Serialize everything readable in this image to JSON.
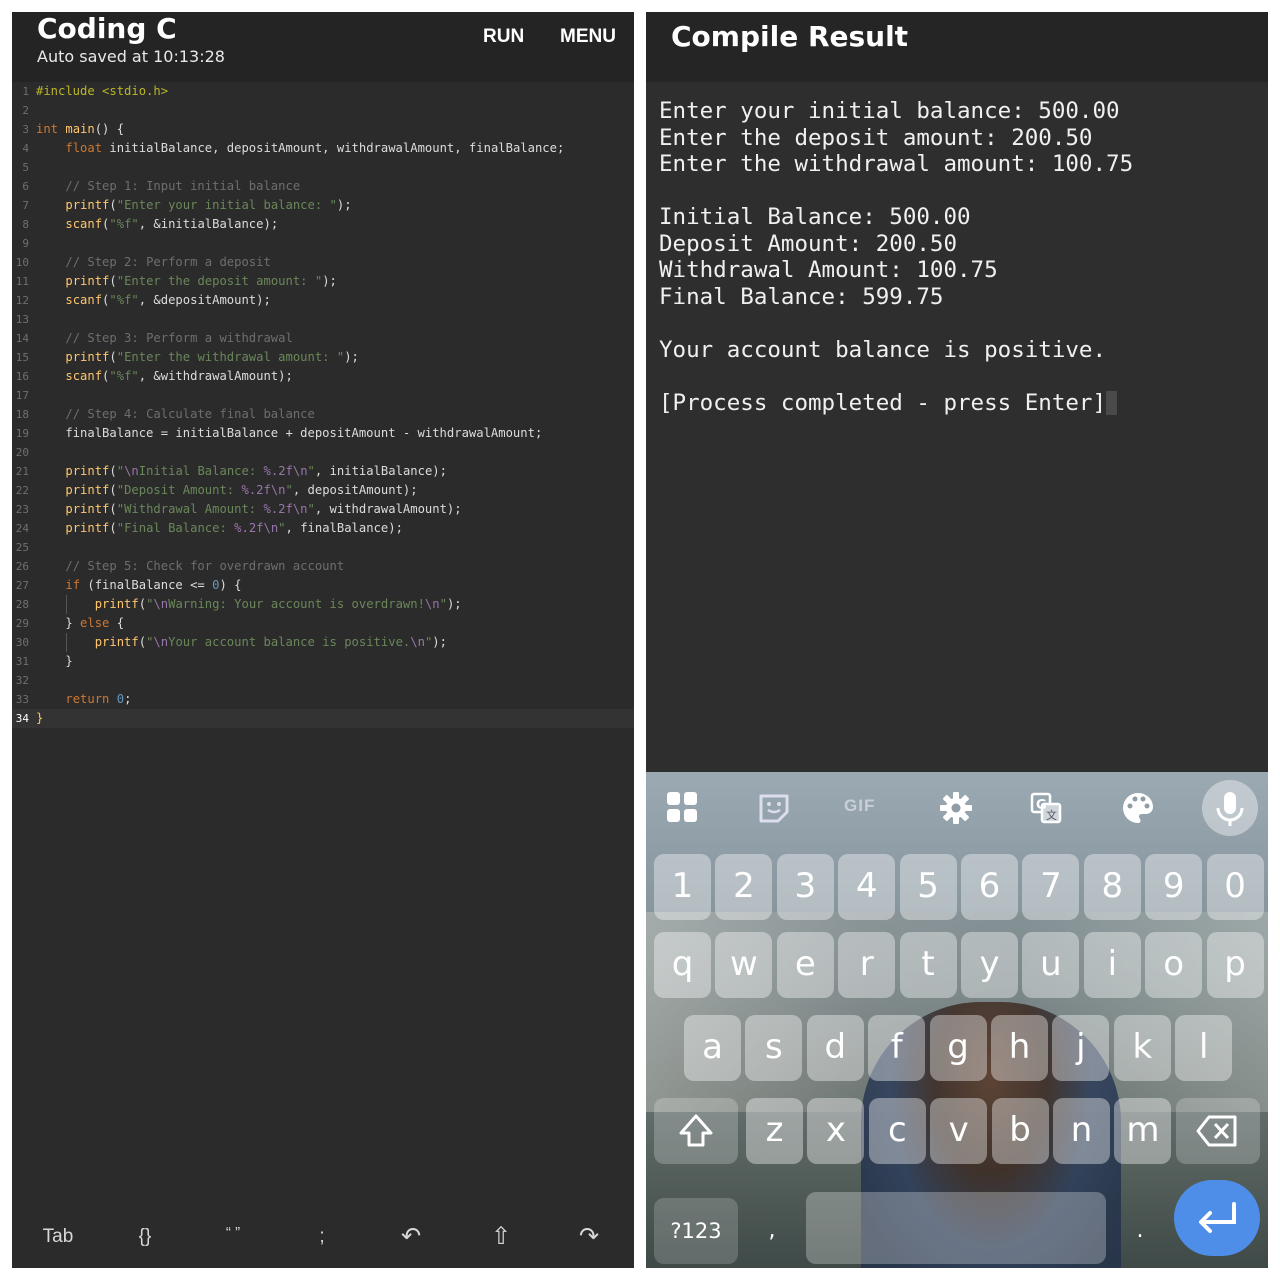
{
  "editor": {
    "app_title": "Coding C",
    "autosave": "Auto saved at 10:13:28",
    "run_label": "RUN",
    "menu_label": "MENU",
    "lines": [
      {
        "n": "1",
        "tokens": [
          [
            "pp",
            "#include <stdio.h>"
          ]
        ]
      },
      {
        "n": "2",
        "tokens": []
      },
      {
        "n": "3",
        "tokens": [
          [
            "kw",
            "int "
          ],
          [
            "fn",
            "main"
          ],
          [
            "plain",
            "() {"
          ]
        ]
      },
      {
        "n": "4",
        "tokens": [
          [
            "plain",
            "    "
          ],
          [
            "kw",
            "float "
          ],
          [
            "plain",
            "initialBalance, depositAmount, withdrawalAmount, finalBalance;"
          ]
        ]
      },
      {
        "n": "5",
        "tokens": []
      },
      {
        "n": "6",
        "tokens": [
          [
            "plain",
            "    "
          ],
          [
            "com",
            "// Step 1: Input initial balance"
          ]
        ]
      },
      {
        "n": "7",
        "tokens": [
          [
            "plain",
            "    "
          ],
          [
            "fn",
            "printf"
          ],
          [
            "plain",
            "("
          ],
          [
            "str",
            "\"Enter your initial balance: \""
          ],
          [
            "plain",
            ");"
          ]
        ]
      },
      {
        "n": "8",
        "tokens": [
          [
            "plain",
            "    "
          ],
          [
            "fn",
            "scanf"
          ],
          [
            "plain",
            "("
          ],
          [
            "str",
            "\"%f\""
          ],
          [
            "plain",
            ", &initialBalance);"
          ]
        ]
      },
      {
        "n": "9",
        "tokens": []
      },
      {
        "n": "10",
        "tokens": [
          [
            "plain",
            "    "
          ],
          [
            "com",
            "// Step 2: Perform a deposit"
          ]
        ]
      },
      {
        "n": "11",
        "tokens": [
          [
            "plain",
            "    "
          ],
          [
            "fn",
            "printf"
          ],
          [
            "plain",
            "("
          ],
          [
            "str",
            "\"Enter the deposit amount: \""
          ],
          [
            "plain",
            ");"
          ]
        ]
      },
      {
        "n": "12",
        "tokens": [
          [
            "plain",
            "    "
          ],
          [
            "fn",
            "scanf"
          ],
          [
            "plain",
            "("
          ],
          [
            "str",
            "\"%f\""
          ],
          [
            "plain",
            ", &depositAmount);"
          ]
        ]
      },
      {
        "n": "13",
        "tokens": []
      },
      {
        "n": "14",
        "tokens": [
          [
            "plain",
            "    "
          ],
          [
            "com",
            "// Step 3: Perform a withdrawal"
          ]
        ]
      },
      {
        "n": "15",
        "tokens": [
          [
            "plain",
            "    "
          ],
          [
            "fn",
            "printf"
          ],
          [
            "plain",
            "("
          ],
          [
            "str",
            "\"Enter the withdrawal amount: \""
          ],
          [
            "plain",
            ");"
          ]
        ]
      },
      {
        "n": "16",
        "tokens": [
          [
            "plain",
            "    "
          ],
          [
            "fn",
            "scanf"
          ],
          [
            "plain",
            "("
          ],
          [
            "str",
            "\"%f\""
          ],
          [
            "plain",
            ", &withdrawalAmount);"
          ]
        ]
      },
      {
        "n": "17",
        "tokens": []
      },
      {
        "n": "18",
        "tokens": [
          [
            "plain",
            "    "
          ],
          [
            "com",
            "// Step 4: Calculate final balance"
          ]
        ]
      },
      {
        "n": "19",
        "tokens": [
          [
            "plain",
            "    finalBalance = initialBalance + depositAmount - withdrawalAmount;"
          ]
        ]
      },
      {
        "n": "20",
        "tokens": []
      },
      {
        "n": "21",
        "tokens": [
          [
            "plain",
            "    "
          ],
          [
            "fn",
            "printf"
          ],
          [
            "plain",
            "("
          ],
          [
            "str",
            "\""
          ],
          [
            "esc",
            "\\n"
          ],
          [
            "str",
            "Initial Balance: "
          ],
          [
            "esc",
            "%.2f\\n"
          ],
          [
            "str",
            "\""
          ],
          [
            "plain",
            ", initialBalance);"
          ]
        ]
      },
      {
        "n": "22",
        "tokens": [
          [
            "plain",
            "    "
          ],
          [
            "fn",
            "printf"
          ],
          [
            "plain",
            "("
          ],
          [
            "str",
            "\"Deposit Amount: "
          ],
          [
            "esc",
            "%.2f\\n"
          ],
          [
            "str",
            "\""
          ],
          [
            "plain",
            ", depositAmount);"
          ]
        ]
      },
      {
        "n": "23",
        "tokens": [
          [
            "plain",
            "    "
          ],
          [
            "fn",
            "printf"
          ],
          [
            "plain",
            "("
          ],
          [
            "str",
            "\"Withdrawal Amount: "
          ],
          [
            "esc",
            "%.2f\\n"
          ],
          [
            "str",
            "\""
          ],
          [
            "plain",
            ", withdrawalAmount);"
          ]
        ]
      },
      {
        "n": "24",
        "tokens": [
          [
            "plain",
            "    "
          ],
          [
            "fn",
            "printf"
          ],
          [
            "plain",
            "("
          ],
          [
            "str",
            "\"Final Balance: "
          ],
          [
            "esc",
            "%.2f\\n"
          ],
          [
            "str",
            "\""
          ],
          [
            "plain",
            ", finalBalance);"
          ]
        ]
      },
      {
        "n": "25",
        "tokens": []
      },
      {
        "n": "26",
        "tokens": [
          [
            "plain",
            "    "
          ],
          [
            "com",
            "// Step 5: Check for overdrawn account"
          ]
        ]
      },
      {
        "n": "27",
        "tokens": [
          [
            "plain",
            "    "
          ],
          [
            "kw",
            "if "
          ],
          [
            "plain",
            "(finalBalance <= "
          ],
          [
            "num",
            "0"
          ],
          [
            "plain",
            ") {"
          ]
        ]
      },
      {
        "n": "28",
        "tokens": [
          [
            "plain",
            "        "
          ],
          [
            "fn",
            "printf"
          ],
          [
            "plain",
            "("
          ],
          [
            "str",
            "\""
          ],
          [
            "esc",
            "\\n"
          ],
          [
            "str",
            "Warning: Your account is overdrawn!"
          ],
          [
            "esc",
            "\\n"
          ],
          [
            "str",
            "\""
          ],
          [
            "plain",
            ");"
          ]
        ]
      },
      {
        "n": "29",
        "tokens": [
          [
            "plain",
            "    } "
          ],
          [
            "kw",
            "else "
          ],
          [
            "plain",
            "{"
          ]
        ]
      },
      {
        "n": "30",
        "tokens": [
          [
            "plain",
            "        "
          ],
          [
            "fn",
            "printf"
          ],
          [
            "plain",
            "("
          ],
          [
            "str",
            "\""
          ],
          [
            "esc",
            "\\n"
          ],
          [
            "str",
            "Your account balance is positive."
          ],
          [
            "esc",
            "\\n"
          ],
          [
            "str",
            "\""
          ],
          [
            "plain",
            ");"
          ]
        ]
      },
      {
        "n": "31",
        "tokens": [
          [
            "plain",
            "    }"
          ]
        ]
      },
      {
        "n": "32",
        "tokens": []
      },
      {
        "n": "33",
        "tokens": [
          [
            "plain",
            "    "
          ],
          [
            "kw",
            "return "
          ],
          [
            "num",
            "0"
          ],
          [
            "plain",
            ";"
          ]
        ]
      },
      {
        "n": "34",
        "tokens": [
          [
            "fn",
            "}"
          ]
        ],
        "current": true
      }
    ],
    "bottom_bar": [
      {
        "name": "tab-key",
        "label": "Tab"
      },
      {
        "name": "braces-key",
        "label": "{}"
      },
      {
        "name": "quotes-key",
        "label": "“ ”"
      },
      {
        "name": "semicolon-key",
        "label": ";"
      },
      {
        "name": "undo-key",
        "label": "↶",
        "icon": "undo-icon"
      },
      {
        "name": "shift-key",
        "label": "⇧",
        "icon": "shift-arrow-icon"
      },
      {
        "name": "redo-key",
        "label": "↷",
        "icon": "redo-icon"
      }
    ]
  },
  "result": {
    "title": "Compile Result",
    "output_lines": [
      "Enter your initial balance: 500.00",
      "Enter the deposit amount: 200.50",
      "Enter the withdrawal amount: 100.75",
      "",
      "Initial Balance: 500.00",
      "Deposit Amount: 200.50",
      "Withdrawal Amount: 100.75",
      "Final Balance: 599.75",
      "",
      "Your account balance is positive.",
      "",
      "[Process completed - press Enter]"
    ]
  },
  "keyboard": {
    "toolbar": [
      {
        "name": "apps-grid-icon"
      },
      {
        "name": "sticker-icon"
      },
      {
        "name": "gif-icon",
        "label": "GIF"
      },
      {
        "name": "settings-gear-icon"
      },
      {
        "name": "translate-icon"
      },
      {
        "name": "palette-icon"
      },
      {
        "name": "microphone-icon"
      }
    ],
    "row_numbers": [
      "1",
      "2",
      "3",
      "4",
      "5",
      "6",
      "7",
      "8",
      "9",
      "0"
    ],
    "row_top": [
      "q",
      "w",
      "e",
      "r",
      "t",
      "y",
      "u",
      "i",
      "o",
      "p"
    ],
    "row_home": [
      "a",
      "s",
      "d",
      "f",
      "g",
      "h",
      "j",
      "k",
      "l"
    ],
    "row_bottom": [
      "z",
      "x",
      "c",
      "v",
      "b",
      "n",
      "m"
    ],
    "symbols_label": "?123",
    "comma_label": ",",
    "period_label": ".",
    "colors": {
      "enter": "#4f8ee8",
      "key_text": "#ffffff"
    }
  },
  "colors": {
    "editor_bg": "#2b2b2b",
    "keyword": "#cc7832",
    "function": "#ffc66d",
    "string": "#6a8759",
    "comment": "#6e6e6e",
    "number": "#6897bb",
    "preprocessor": "#bbb529"
  }
}
